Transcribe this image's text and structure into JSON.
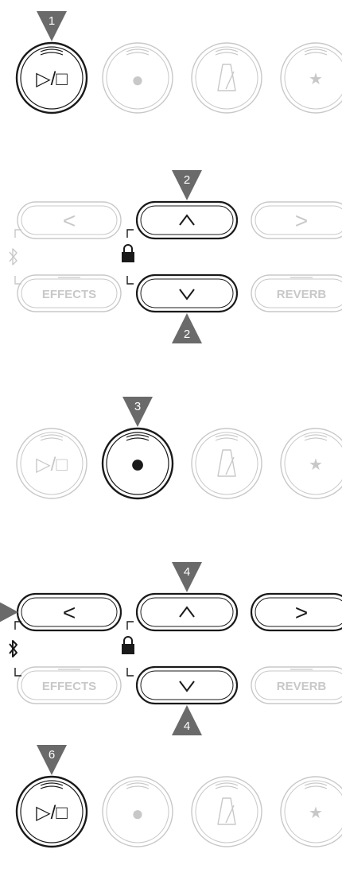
{
  "glyphs": {
    "play_stop": "▷/□",
    "record": "●",
    "metronome": "metronome-icon",
    "favorite": "★",
    "left": "<",
    "right": ">",
    "up": "^",
    "down": "v",
    "bluetooth": "bluetooth-icon",
    "lock": "lock-icon"
  },
  "labels": {
    "effects": "EFFECTS",
    "reverb": "REVERB"
  },
  "steps": {
    "s1": "1",
    "s2_top": "2",
    "s2_bottom": "2",
    "s3": "3",
    "s4_top": "4",
    "s4_bottom": "4",
    "s6": "6"
  },
  "panels": [
    {
      "id": "panel-1",
      "type": "circle-row",
      "active": [
        "play_stop"
      ],
      "markers": [
        {
          "step": "s1",
          "target": "play_stop",
          "direction": "down"
        }
      ]
    },
    {
      "id": "panel-2",
      "type": "pill-grid",
      "active": [
        "up",
        "down"
      ],
      "markers": [
        {
          "step": "s2_top",
          "target": "up",
          "direction": "down"
        },
        {
          "step": "s2_bottom",
          "target": "down",
          "direction": "up"
        }
      ]
    },
    {
      "id": "panel-3",
      "type": "circle-row",
      "active": [
        "record"
      ],
      "markers": [
        {
          "step": "s3",
          "target": "record",
          "direction": "down"
        }
      ]
    },
    {
      "id": "panel-4",
      "type": "pill-grid",
      "active": [
        "left",
        "up",
        "right",
        "down",
        "bluetooth"
      ],
      "markers": [
        {
          "step": "s4_top",
          "target": "up",
          "direction": "down"
        },
        {
          "step": "s4_bottom",
          "target": "down",
          "direction": "up"
        },
        {
          "step": null,
          "target": "left",
          "direction": "right"
        }
      ]
    },
    {
      "id": "panel-6",
      "type": "circle-row",
      "active": [
        "play_stop"
      ],
      "markers": [
        {
          "step": "s6",
          "target": "play_stop",
          "direction": "down"
        }
      ]
    }
  ],
  "colors": {
    "active_stroke": "#1a1a1a",
    "inactive_stroke": "#c8c8c8",
    "inactive_fill": "#c8c8c8",
    "marker_fill": "#6a6a6a",
    "marker_text": "#ffffff",
    "background": "#ffffff"
  }
}
